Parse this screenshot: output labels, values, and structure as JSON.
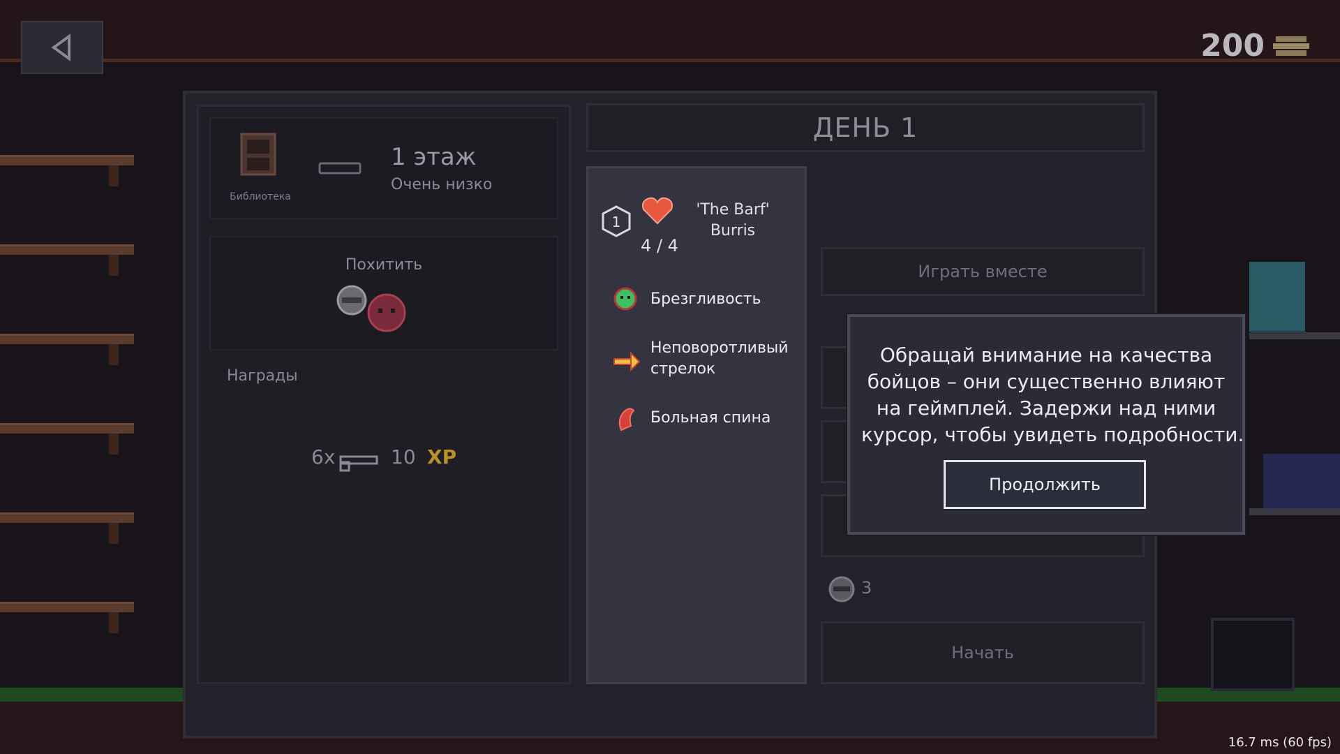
{
  "header": {
    "coins": "200"
  },
  "location": {
    "name": "Библиотека",
    "floor": "1 этаж",
    "level": "Очень низко"
  },
  "abduct": {
    "label": "Похитить"
  },
  "rewards": {
    "label": "Награды",
    "item_count": "6x",
    "xp_amount": "10",
    "xp_label": "XP"
  },
  "day": {
    "title": "ДЕНЬ 1"
  },
  "fighter": {
    "number": "1",
    "hp": "4 / 4",
    "name_line1": "'The Barf'",
    "name_line2": "Burris",
    "traits": [
      {
        "label": "Брезгливость",
        "icon": "green-slime-icon"
      },
      {
        "label_line1": "Неповоротливый",
        "label_line2": "стрелок",
        "icon": "arrow-icon"
      },
      {
        "label": "Больная спина",
        "icon": "back-pain-icon"
      }
    ]
  },
  "actions": {
    "play_together": "Играть вместе",
    "start": "Начать",
    "team_count": "3"
  },
  "tooltip": {
    "text_line1": "Обращай внимание на качества",
    "text_line2": "бойцов – они существенно влияют",
    "text_line3": "на геймплей. Задержи над ними",
    "text_line4": "курсор, чтобы увидеть подробности.",
    "continue": "Продолжить"
  },
  "debug": {
    "fps": "16.7 ms (60 fps)"
  },
  "colors": {
    "xp": "#b8912a",
    "heart": "#e8573e",
    "tooltip_border": "#4a4b58"
  }
}
